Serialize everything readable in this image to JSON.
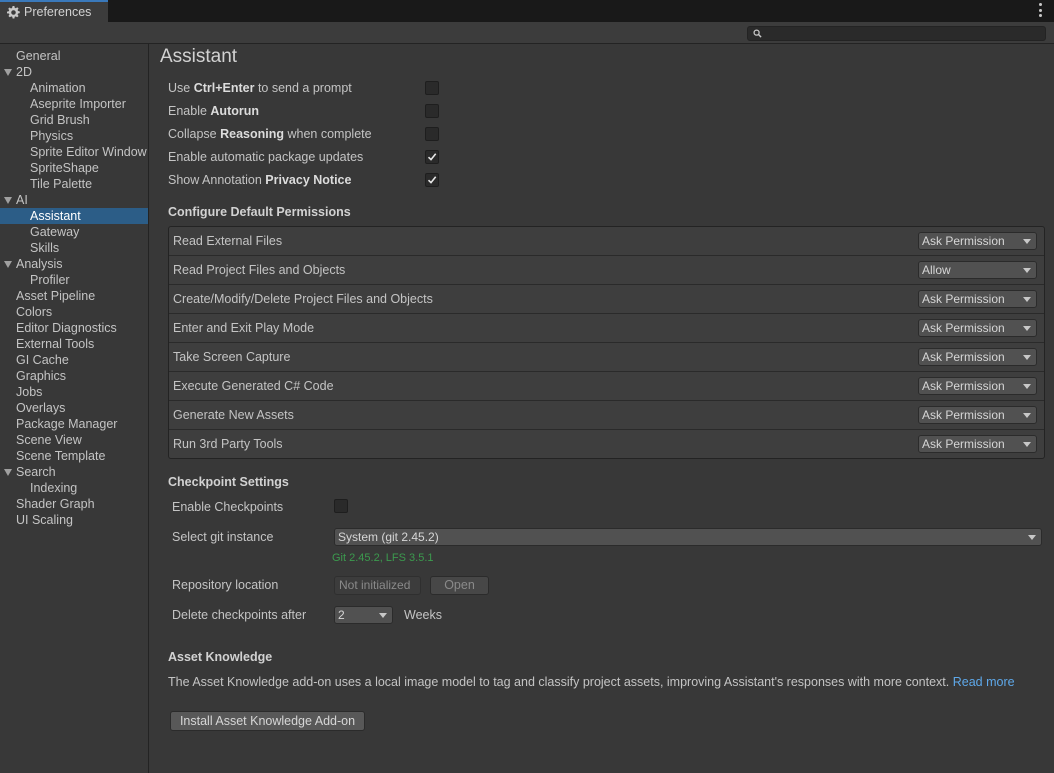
{
  "window": {
    "tab_title": "Preferences"
  },
  "sidebar": {
    "items": [
      {
        "label": "General",
        "level": 0
      },
      {
        "label": "2D",
        "level": 0,
        "expandable": true
      },
      {
        "label": "Animation",
        "level": 1
      },
      {
        "label": "Aseprite Importer",
        "level": 1
      },
      {
        "label": "Grid Brush",
        "level": 1
      },
      {
        "label": "Physics",
        "level": 1
      },
      {
        "label": "Sprite Editor Window",
        "level": 1
      },
      {
        "label": "SpriteShape",
        "level": 1
      },
      {
        "label": "Tile Palette",
        "level": 1
      },
      {
        "label": "AI",
        "level": 0,
        "expandable": true
      },
      {
        "label": "Assistant",
        "level": 1,
        "selected": true
      },
      {
        "label": "Gateway",
        "level": 1
      },
      {
        "label": "Skills",
        "level": 1
      },
      {
        "label": "Analysis",
        "level": 0,
        "expandable": true
      },
      {
        "label": "Profiler",
        "level": 1
      },
      {
        "label": "Asset Pipeline",
        "level": 0
      },
      {
        "label": "Colors",
        "level": 0
      },
      {
        "label": "Editor Diagnostics",
        "level": 0
      },
      {
        "label": "External Tools",
        "level": 0
      },
      {
        "label": "GI Cache",
        "level": 0
      },
      {
        "label": "Graphics",
        "level": 0
      },
      {
        "label": "Jobs",
        "level": 0
      },
      {
        "label": "Overlays",
        "level": 0
      },
      {
        "label": "Package Manager",
        "level": 0
      },
      {
        "label": "Scene View",
        "level": 0
      },
      {
        "label": "Scene Template",
        "level": 0
      },
      {
        "label": "Search",
        "level": 0,
        "expandable": true
      },
      {
        "label": "Indexing",
        "level": 1
      },
      {
        "label": "Shader Graph",
        "level": 0
      },
      {
        "label": "UI Scaling",
        "level": 0
      }
    ]
  },
  "main": {
    "title": "Assistant",
    "toggles": [
      {
        "pre": "Use ",
        "bold": "Ctrl+Enter",
        "post": " to send a prompt",
        "checked": false
      },
      {
        "pre": "Enable ",
        "bold": "Autorun",
        "post": "",
        "checked": false
      },
      {
        "pre": "Collapse ",
        "bold": "Reasoning",
        "post": " when complete",
        "checked": false
      },
      {
        "pre": "Enable automatic package updates",
        "bold": "",
        "post": "",
        "checked": true
      },
      {
        "pre": "Show Annotation ",
        "bold": "Privacy Notice",
        "post": "",
        "checked": true
      }
    ],
    "permissions": {
      "title": "Configure Default Permissions",
      "rows": [
        {
          "label": "Read External Files",
          "value": "Ask Permission"
        },
        {
          "label": "Read Project Files and Objects",
          "value": "Allow"
        },
        {
          "label": "Create/Modify/Delete Project Files and Objects",
          "value": "Ask Permission"
        },
        {
          "label": "Enter and Exit Play Mode",
          "value": "Ask Permission"
        },
        {
          "label": "Take Screen Capture",
          "value": "Ask Permission"
        },
        {
          "label": "Execute Generated C# Code",
          "value": "Ask Permission"
        },
        {
          "label": "Generate New Assets",
          "value": "Ask Permission"
        },
        {
          "label": "Run 3rd Party Tools",
          "value": "Ask Permission"
        }
      ]
    },
    "checkpoints": {
      "title": "Checkpoint Settings",
      "enable_label": "Enable Checkpoints",
      "enable_checked": false,
      "git_label": "Select git instance",
      "git_value": "System (git 2.45.2)",
      "git_version": "Git 2.45.2, LFS 3.5.1",
      "repo_label": "Repository location",
      "repo_value": "Not initialized",
      "open_label": "Open",
      "delete_label": "Delete checkpoints after",
      "delete_value": "2",
      "delete_unit": "Weeks"
    },
    "asset_knowledge": {
      "title": "Asset Knowledge",
      "description": "The Asset Knowledge add-on uses a local image model to tag and classify project assets, improving Assistant's responses with more context.",
      "read_more": "Read more",
      "install_label": "Install Asset Knowledge Add-on"
    }
  },
  "colors": {
    "selection": "#2c5d87",
    "link": "#5ea8e9",
    "git_ok": "#3c9a4e"
  }
}
